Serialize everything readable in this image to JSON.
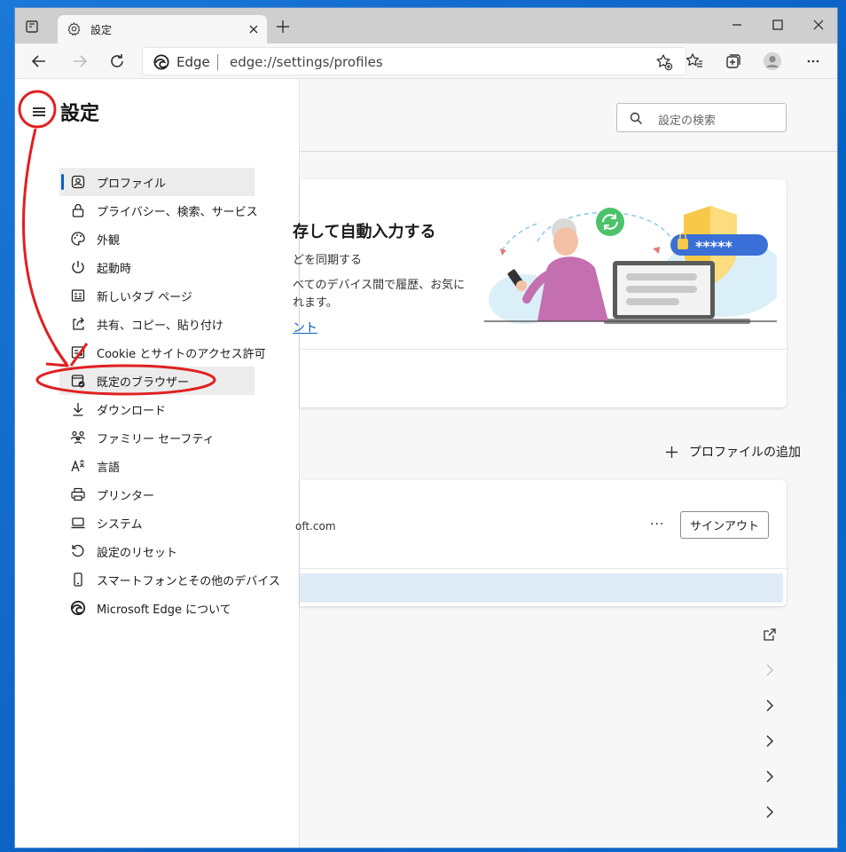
{
  "tab": {
    "title": "設定"
  },
  "address": {
    "site": "Edge",
    "url": "edge://settings/profiles"
  },
  "sidebar": {
    "title": "設定",
    "items": [
      {
        "label": "プロファイル",
        "icon": "profile-icon"
      },
      {
        "label": "プライバシー、検索、サービス",
        "icon": "lock-icon"
      },
      {
        "label": "外観",
        "icon": "palette-icon"
      },
      {
        "label": "起動時",
        "icon": "power-icon"
      },
      {
        "label": "新しいタブ ページ",
        "icon": "new-tab-page-icon"
      },
      {
        "label": "共有、コピー、貼り付け",
        "icon": "share-icon"
      },
      {
        "label": "Cookie とサイトのアクセス許可",
        "icon": "cookie-icon"
      },
      {
        "label": "既定のブラウザー",
        "icon": "default-browser-icon"
      },
      {
        "label": "ダウンロード",
        "icon": "download-icon"
      },
      {
        "label": "ファミリー セーフティ",
        "icon": "family-icon"
      },
      {
        "label": "言語",
        "icon": "language-icon"
      },
      {
        "label": "プリンター",
        "icon": "printer-icon"
      },
      {
        "label": "システム",
        "icon": "laptop-icon"
      },
      {
        "label": "設定のリセット",
        "icon": "reset-icon"
      },
      {
        "label": "スマートフォンとその他のデバイス",
        "icon": "phone-icon"
      },
      {
        "label": "Microsoft Edge について",
        "icon": "edge-icon"
      }
    ]
  },
  "main": {
    "search_placeholder": "設定の検索",
    "sync_card": {
      "title": "存して自動入力する",
      "line1": "どを同期する",
      "line2": "べてのデバイス間で履歴、お気に",
      "line3": "れます。",
      "link": "ント",
      "password_mask": "*****"
    },
    "add_profile": "プロファイルの追加",
    "profile_card": {
      "email": "oft.com",
      "more": "···",
      "sign_out": "サインアウト"
    }
  },
  "colors": {
    "accent": "#0a5fc2",
    "annotation": "#e02020",
    "desktop": "#1a78d8"
  }
}
